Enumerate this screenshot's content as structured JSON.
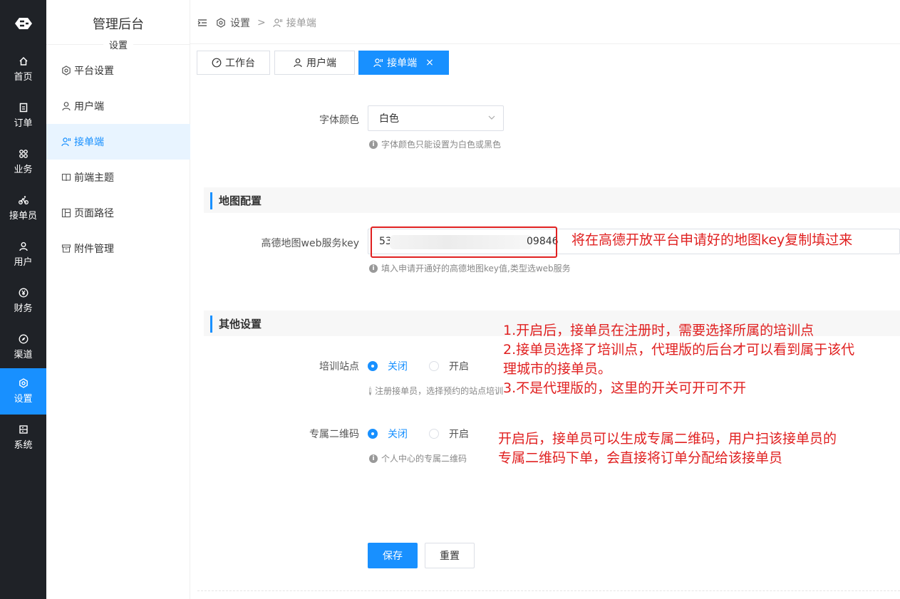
{
  "rail": {
    "items": [
      {
        "label": "首页",
        "icon": "home-icon"
      },
      {
        "label": "订单",
        "icon": "order-icon"
      },
      {
        "label": "业务",
        "icon": "grid-icon"
      },
      {
        "label": "接单员",
        "icon": "bike-icon"
      },
      {
        "label": "用户",
        "icon": "user-icon"
      },
      {
        "label": "财务",
        "icon": "yen-icon"
      },
      {
        "label": "渠道",
        "icon": "compass-icon"
      },
      {
        "label": "设置",
        "icon": "settings-icon"
      },
      {
        "label": "系统",
        "icon": "system-icon"
      }
    ],
    "active_index": 7
  },
  "sub_menu": {
    "title": "管理后台",
    "subtitle": "设置",
    "items": [
      {
        "label": "平台设置"
      },
      {
        "label": "用户端"
      },
      {
        "label": "接单端"
      },
      {
        "label": "前端主题"
      },
      {
        "label": "页面路径"
      },
      {
        "label": "附件管理"
      }
    ],
    "active_index": 2
  },
  "breadcrumb": {
    "root": "设置",
    "separator": ">",
    "current": "接单端"
  },
  "tabs": [
    {
      "label": "工作台"
    },
    {
      "label": "用户端"
    },
    {
      "label": "接单端",
      "close": "×"
    }
  ],
  "form": {
    "font_color": {
      "label": "字体颜色",
      "value": "白色",
      "hint": "字体颜色只能设置为白色或黑色"
    },
    "map_section": {
      "title": "地图配置"
    },
    "amap_key": {
      "label": "高德地图web服务key",
      "value_start": "53a",
      "value_end": "09846",
      "hint": "填入申请开通好的高德地图key值,类型选web服务"
    },
    "other_section": {
      "title": "其他设置"
    },
    "training_site": {
      "label": "培训站点",
      "opt_off": "关闭",
      "opt_on": "开启",
      "hint": "注册接单员，选择预约的站点培训"
    },
    "qr_code": {
      "label": "专属二维码",
      "opt_off": "关闭",
      "opt_on": "开启",
      "hint": "个人中心的专属二维码"
    },
    "save_label": "保存",
    "reset_label": "重置"
  },
  "annotations": {
    "key_note": "将在高德开放平台申请好的地图key复制填过来",
    "training_note": [
      "1.开启后，接单员在注册时，需要选择所属的培训点",
      "2.接单员选择了培训点，代理版的后台才可以看到属于该代",
      "理城市的接单员。",
      "3.不是代理版的，这里的开关可开可不开"
    ],
    "qr_note": [
      "开启后，接单员可以生成专属二维码，用户扫该接单员的",
      "专属二维码下单，会直接将订单分配给该接单员"
    ]
  },
  "colors": {
    "accent": "#1890ff",
    "rail_bg": "#1f2227",
    "annotation": "#e02020"
  }
}
